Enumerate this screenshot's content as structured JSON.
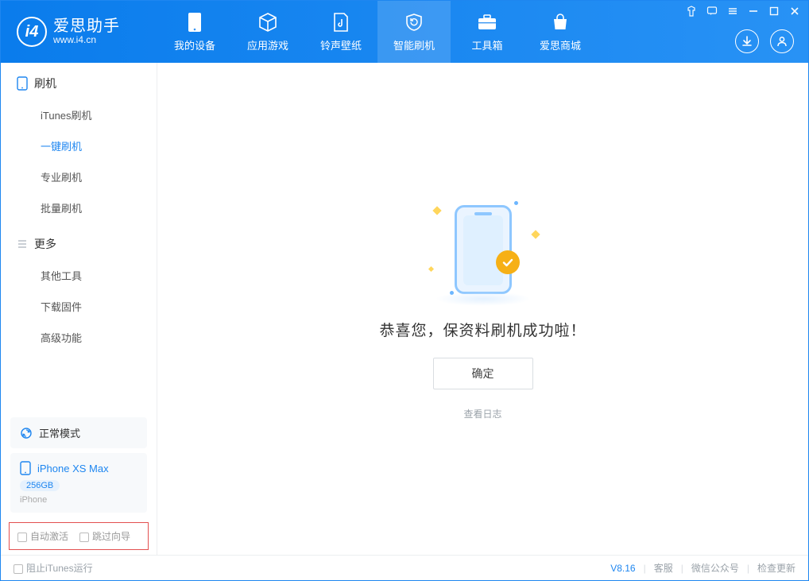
{
  "app": {
    "name_cn": "爱思助手",
    "name_en": "www.i4.cn"
  },
  "nav": {
    "device": "我的设备",
    "apps": "应用游戏",
    "ring": "铃声壁纸",
    "flash": "智能刷机",
    "toolbox": "工具箱",
    "store": "爱思商城"
  },
  "sidebar": {
    "section1_title": "刷机",
    "items1": [
      "iTunes刷机",
      "一键刷机",
      "专业刷机",
      "批量刷机"
    ],
    "section2_title": "更多",
    "items2": [
      "其他工具",
      "下载固件",
      "高级功能"
    ],
    "mode_label": "正常模式",
    "device_name": "iPhone XS Max",
    "capacity": "256GB",
    "device_type": "iPhone",
    "opt_auto_activate": "自动激活",
    "opt_skip_guide": "跳过向导"
  },
  "main": {
    "success": "恭喜您，保资料刷机成功啦！",
    "confirm": "确定",
    "view_log": "查看日志"
  },
  "statusbar": {
    "block_itunes": "阻止iTunes运行",
    "version": "V8.16",
    "support": "客服",
    "wechat": "微信公众号",
    "update": "检查更新"
  }
}
